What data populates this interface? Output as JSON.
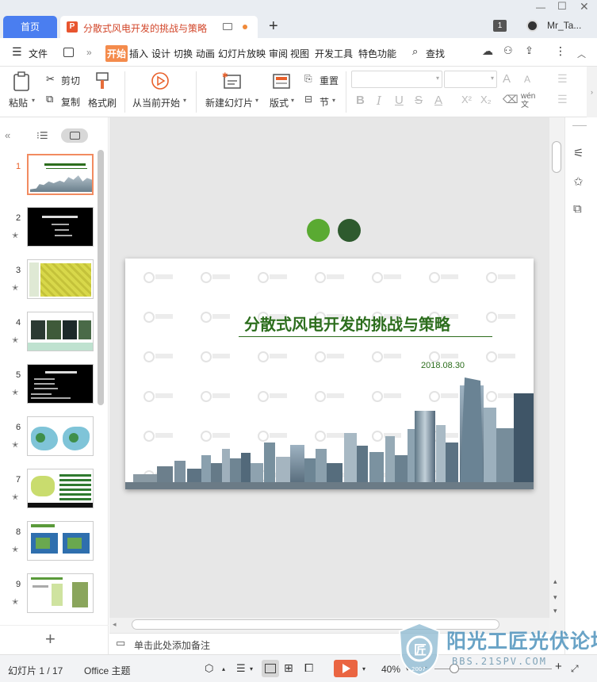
{
  "tabs": {
    "home": "首页",
    "doc_title": "分散式风电开发的挑战与策略"
  },
  "window": {
    "badge": "1",
    "user": "Mr_Ta..."
  },
  "menu": {
    "file": "文件",
    "items": [
      "开始",
      "插入",
      "设计",
      "切换",
      "动画",
      "幻灯片放映",
      "审阅",
      "视图",
      "开发工具",
      "特色功能"
    ],
    "search": "查找"
  },
  "ribbon": {
    "paste": "粘贴",
    "cut": "剪切",
    "copy": "复制",
    "format_painter": "格式刷",
    "from_current": "从当前开始",
    "new_slide": "新建幻灯片",
    "layout": "版式",
    "reset": "重置",
    "section": "节"
  },
  "slides": [
    {
      "num": "1"
    },
    {
      "num": "2"
    },
    {
      "num": "3"
    },
    {
      "num": "4"
    },
    {
      "num": "5"
    },
    {
      "num": "6"
    },
    {
      "num": "7"
    },
    {
      "num": "8"
    },
    {
      "num": "9"
    }
  ],
  "slide_content": {
    "title": "分散式风电开发的挑战与策略",
    "date": "2018.08.30",
    "colors": {
      "green_light": "#5aaa32",
      "green_dark": "#2e5a2e",
      "title_green": "#2d6e1e"
    }
  },
  "notes_placeholder": "单击此处添加备注",
  "status": {
    "slide_counter": "幻灯片 1 / 17",
    "theme": "Office 主题",
    "zoom": "40%"
  },
  "watermark": {
    "text": "阳光工匠光伏论坛",
    "url": "BBS.21SPV.COM",
    "year": "2007"
  }
}
